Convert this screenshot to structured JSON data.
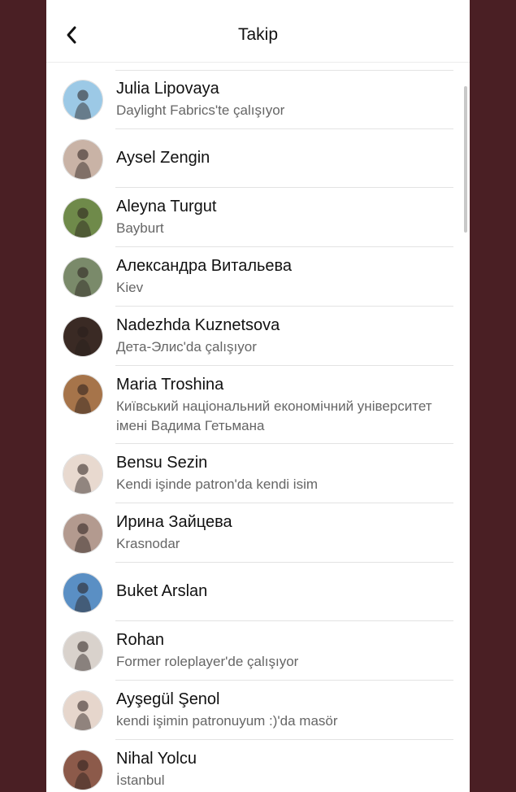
{
  "header": {
    "title": "Takip",
    "back_icon": "chevron-left-icon"
  },
  "people": [
    {
      "name": "Julia  Lipovaya",
      "subtitle": "Daylight Fabrics'te çalışıyor",
      "avatar_bg": "#9cc9e6"
    },
    {
      "name": "Aysel Zengin",
      "subtitle": "",
      "avatar_bg": "#c9b3a6"
    },
    {
      "name": "Aleyna Turgut",
      "subtitle": "Bayburt",
      "avatar_bg": "#6f8a4a"
    },
    {
      "name": "Александра Витальева",
      "subtitle": "Kiev",
      "avatar_bg": "#7a8a6a"
    },
    {
      "name": "Nadezhda  Kuznetsova",
      "subtitle": "Дета-Элис'da çalışıyor",
      "avatar_bg": "#3a2a24"
    },
    {
      "name": "Maria  Troshina",
      "subtitle": "Київський національний економічний університет імені Вадима Гетьмана",
      "avatar_bg": "#a6744a"
    },
    {
      "name": "Bensu Sezin",
      "subtitle": "Kendi işinde patron'da kendi isim",
      "avatar_bg": "#e8d9cf"
    },
    {
      "name": "Ирина Зайцева",
      "subtitle": "Krasnodar",
      "avatar_bg": "#b39a8f"
    },
    {
      "name": "Buket Arslan",
      "subtitle": "",
      "avatar_bg": "#5a8fc4"
    },
    {
      "name": "Rohan",
      "subtitle": "Former roleplayer'de çalışıyor",
      "avatar_bg": "#d9d2cc"
    },
    {
      "name": "Ayşegül Şenol",
      "subtitle": "kendi işimin patronuyum :)'da masör",
      "avatar_bg": "#e6d6cc"
    },
    {
      "name": "Nihal Yolcu",
      "subtitle": "İstanbul",
      "avatar_bg": "#8c5a4a"
    }
  ]
}
